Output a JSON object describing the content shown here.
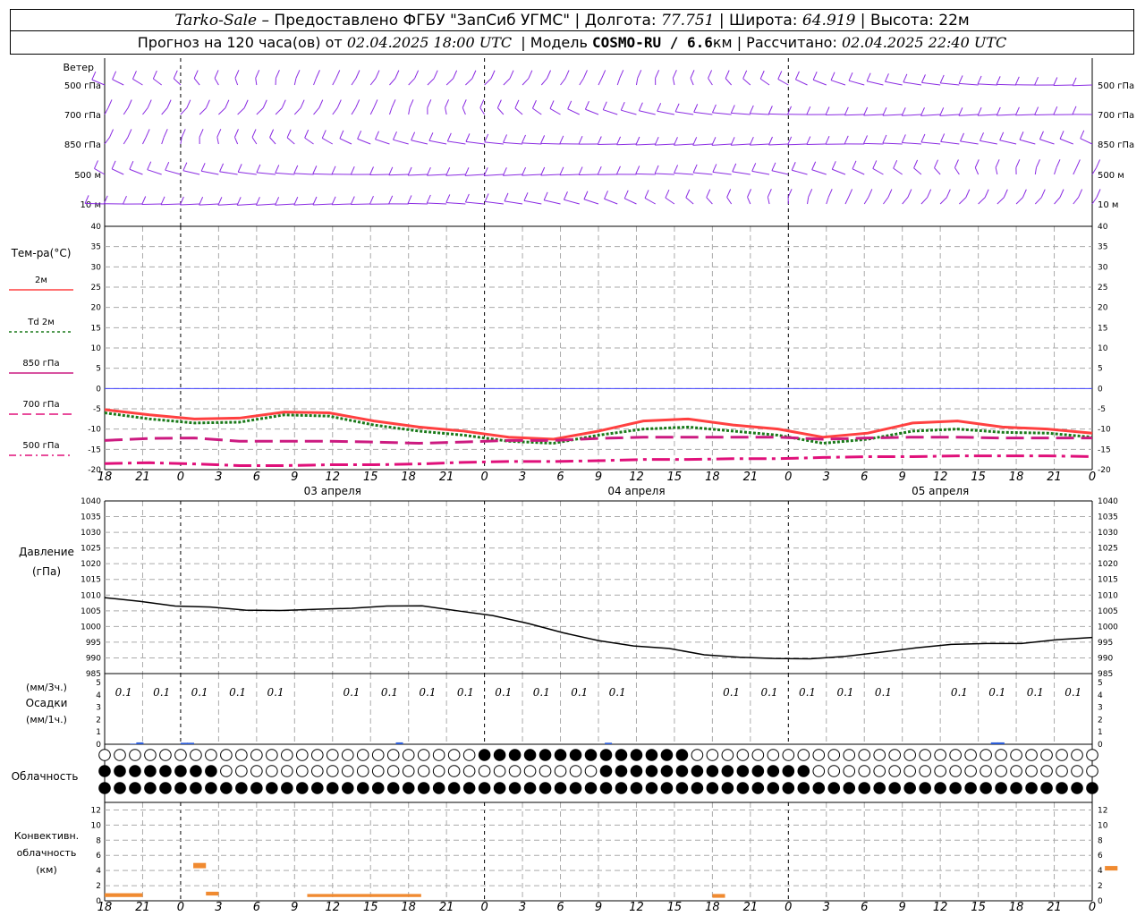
{
  "header": {
    "station": "Tarko-Sale",
    "provider": "– Предоставлено ФГБУ \"ЗапСиб УГМС\"",
    "lon_label": "Долгота:",
    "lon": "77.751",
    "lat_label": "Широта:",
    "lat": "64.919",
    "alt_label": "Высота:",
    "alt": "22м",
    "forecast_label": "Прогноз на 120 часа(ов) от",
    "forecast_from": "02.04.2025 18:00 UTC",
    "model_label": "Модель",
    "model": "COSMO-RU / 6.6",
    "model_unit": "км",
    "calc_label": "Рассчитано:",
    "calc_time": "02.04.2025 22:40 UTC"
  },
  "colors": {
    "wind": "#8a2be2",
    "t2m": "#ff4040",
    "td2m": "#1a7a1a",
    "t850": "#cc1a80",
    "t700": "#e0107a",
    "t500": "#e0107a",
    "pressure": "#000000",
    "precip": "#2a5bd7",
    "convective": "#f08a30",
    "zero_line": "#4040ff"
  },
  "hour_ticks": [
    "18",
    "21",
    "0",
    "3",
    "6",
    "9",
    "12",
    "15",
    "18",
    "21",
    "0",
    "3",
    "6",
    "9",
    "12",
    "15",
    "18",
    "21",
    "0",
    "3",
    "6",
    "9",
    "12",
    "15",
    "18",
    "21",
    "0"
  ],
  "day_labels": [
    "03 апреля",
    "04 апреля",
    "05 апреля"
  ],
  "wind": {
    "title": "Ветер",
    "levels": [
      "500 гПа",
      "700 гПа",
      "850 гПа",
      "500 м",
      "10  м"
    ]
  },
  "chart_data": [
    {
      "type": "line",
      "id": "temperature",
      "ylabel": "Тем-ра(°С)",
      "ylim": [
        -20,
        40
      ],
      "yticks": [
        "40",
        "35",
        "30",
        "25",
        "20",
        "15",
        "10",
        "5",
        "0",
        "-5",
        "-10",
        "-15",
        "-20"
      ],
      "x_hours": [
        0,
        6,
        12,
        18,
        24,
        30,
        36,
        42,
        48,
        54,
        60,
        66,
        72,
        78,
        84,
        90,
        96,
        102,
        108,
        114,
        120
      ],
      "series": [
        {
          "name": "2м",
          "values": [
            -5.2,
            -6.5,
            -7.5,
            -7.3,
            -5.8,
            -6,
            -8,
            -9.5,
            -10.5,
            -12,
            -12.5,
            -10.5,
            -8,
            -7.5,
            -9,
            -10,
            -12,
            -11,
            -8.5,
            -8,
            -9.5,
            -10,
            -11
          ]
        },
        {
          "name": "Td 2м",
          "values": [
            -6,
            -7.5,
            -8.5,
            -8.3,
            -6.5,
            -6.8,
            -9,
            -10.5,
            -11.5,
            -13,
            -13.5,
            -11.5,
            -10,
            -9.5,
            -10.5,
            -11.5,
            -13.5,
            -12.5,
            -10.5,
            -10,
            -10.8,
            -11,
            -12
          ]
        },
        {
          "name": "850 гПа",
          "values": [
            -12.8,
            -12.3,
            -12.2,
            -13,
            -13,
            -13,
            -13.2,
            -13.5,
            -13.2,
            -12.8,
            -12.8,
            -12.3,
            -12,
            -12,
            -12,
            -12,
            -12.5,
            -12.2,
            -12,
            -12,
            -12.2,
            -12.2,
            -12.2
          ]
        },
        {
          "name": "700 гПа",
          "values": [
            -18.5,
            -18.3,
            -18.6,
            -19,
            -19,
            -18.8,
            -18.8,
            -18.6,
            -18.2,
            -18,
            -18,
            -17.8,
            -17.5,
            -17.5,
            -17.3,
            -17.3,
            -17,
            -16.8,
            -16.8,
            -16.6,
            -16.6,
            -16.6,
            -16.8
          ]
        },
        {
          "name": "500 гПа",
          "values": [
            -18.5,
            -18.3,
            -18.6,
            -19,
            -19,
            -18.8,
            -18.8,
            -18.6,
            -18.2,
            -18,
            -18,
            -17.8,
            -17.5,
            -17.5,
            -17.3,
            -17.3,
            -17,
            -16.8,
            -16.8,
            -16.6,
            -16.6,
            -16.6,
            -16.8
          ]
        }
      ]
    },
    {
      "type": "line",
      "id": "pressure",
      "ylabel": "Давление",
      "ylabel2": "(гПа)",
      "ylim": [
        985,
        1040
      ],
      "yticks": [
        "1040",
        "1035",
        "1030",
        "1025",
        "1020",
        "1015",
        "1010",
        "1005",
        "1000",
        "995",
        "990",
        "985"
      ],
      "series": [
        {
          "name": "Давление",
          "values": [
            1009.2,
            1008,
            1006.5,
            1006.2,
            1005.2,
            1005.1,
            1005.5,
            1005.8,
            1006.5,
            1006.6,
            1005,
            1003.5,
            1001,
            998,
            995.5,
            993.8,
            993,
            991,
            990.2,
            989.8,
            989.7,
            990.5,
            991.8,
            993.2,
            994.3,
            994.6,
            994.6,
            995.8,
            996.5
          ]
        }
      ]
    },
    {
      "type": "bar",
      "id": "precipitation",
      "ylabel": "(мм/3ч.)",
      "ylabel2": "Осадки",
      "ylabel3": "(мм/1ч.)",
      "ylim": [
        0,
        5
      ],
      "yticks": [
        "5",
        "4",
        "3",
        "2",
        "1",
        "0"
      ],
      "labels": [
        "0.1",
        "0.1",
        "0.1",
        "0.1",
        "0.1",
        "0.1",
        "0.1",
        "0.1",
        "0.1",
        "0.1",
        "0.1",
        "0.1",
        "0.1",
        "0.1",
        "0.1",
        "0.1",
        "0.1",
        "0.1",
        "0.1",
        "0.1",
        "0.1",
        "0.1"
      ],
      "label_hours": [
        3,
        9,
        15,
        21,
        27,
        39,
        45,
        51,
        57,
        63,
        69,
        75,
        81,
        99,
        105,
        111,
        117,
        123,
        135,
        141,
        147,
        153
      ],
      "bars": [
        {
          "h": 4,
          "v": 0.05
        },
        {
          "h": 5,
          "v": 0.15
        },
        {
          "h": 12,
          "v": 0.12
        },
        {
          "h": 13,
          "v": 0.12
        },
        {
          "h": 46,
          "v": 0.15
        },
        {
          "h": 79,
          "v": 0.12
        },
        {
          "h": 140,
          "v": 0.15
        },
        {
          "h": 141,
          "v": 0.15
        }
      ]
    },
    {
      "type": "table",
      "id": "cloudiness",
      "ylabel": "Облачность",
      "rows": [
        {
          "name": "upper",
          "pattern": "EEEEEEEEEEEEEEEEEEEEEEEEEEEEEEEEEEEEEEEEEEEEEEEEEEEEEEEEEEEEEEEEEEEEEEEEEEEEEEEEEEEEEEEEEEEEEEEEEEEEEEEEEEEEEEEEEEEEEEEEEEEEEEEEEEEEEEEEEEEEEEEEEEEEEEEEEEEE"
        },
        {
          "name": "middle",
          "pattern": ""
        },
        {
          "name": "lower",
          "pattern": ""
        }
      ]
    },
    {
      "type": "bar",
      "id": "convective",
      "ylabel": "Конвективн.",
      "ylabel2": "облачность",
      "ylabel3": "(км)",
      "ylim": [
        0,
        13
      ],
      "yticks": [
        "12",
        "10",
        "8",
        "6",
        "4",
        "2",
        "0"
      ],
      "bars": [
        {
          "from": 0,
          "to": 3,
          "base": 0.5,
          "top": 1.0
        },
        {
          "from": 7,
          "to": 8,
          "base": 4.3,
          "top": 5.0
        },
        {
          "from": 8,
          "to": 9,
          "base": 0.7,
          "top": 1.2
        },
        {
          "from": 79,
          "to": 80,
          "base": 4.0,
          "top": 4.6
        },
        {
          "from": 16,
          "to": 25,
          "base": 0.5,
          "top": 0.9
        },
        {
          "from": 48,
          "to": 49,
          "base": 0.4,
          "top": 0.9
        }
      ]
    }
  ]
}
